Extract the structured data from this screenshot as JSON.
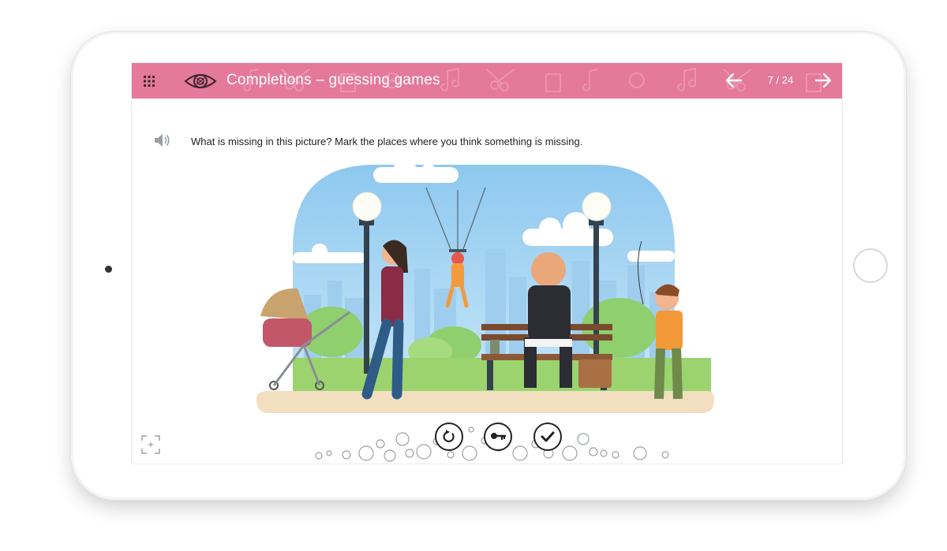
{
  "header": {
    "title": "Completions – guessing games",
    "page_counter": "7 / 24",
    "background_color": "#e4799b"
  },
  "task": {
    "question": "What is missing in this picture? Mark the places where you think something is missing."
  },
  "icons": {
    "menu": "grid-icon",
    "exercise_type": "eye-icon",
    "previous": "arrow-left-icon",
    "next": "arrow-right-icon",
    "audio": "speaker-icon",
    "fullscreen": "fullscreen-icon"
  },
  "controls": [
    {
      "name": "reset",
      "icon": "reset-icon"
    },
    {
      "name": "show-answer",
      "icon": "key-icon"
    },
    {
      "name": "check",
      "icon": "checkmark-icon"
    }
  ]
}
